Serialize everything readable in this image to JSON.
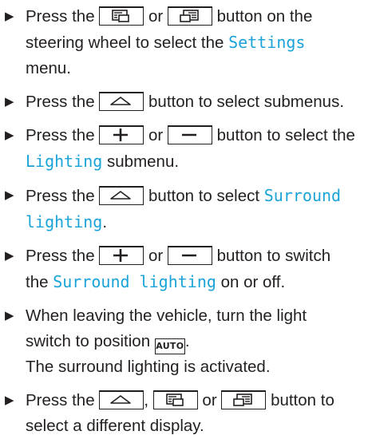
{
  "steps": [
    {
      "pre": "Press the",
      "mid": "or",
      "post": "button on the",
      "line2_pre": "steering wheel to select the",
      "hl": "Settings",
      "line3": "menu."
    },
    {
      "pre": "Press the",
      "post": "button to select submenus."
    },
    {
      "pre": "Press the",
      "mid": "or",
      "post": "button to select the",
      "hl": "Lighting",
      "line2_post": "submenu."
    },
    {
      "pre": "Press the",
      "post": "button to select",
      "hl1": "Surround",
      "hl2": "lighting",
      "end": "."
    },
    {
      "pre": "Press the",
      "mid": "or",
      "post": "button to switch",
      "line2_pre": "the",
      "hl": "Surround lighting",
      "line2_post": "on or off."
    },
    {
      "line1": "When leaving the vehicle, turn the light",
      "line2_pre": "switch to position",
      "auto_label": "AUTO",
      "end": ".",
      "line3": "The surround lighting is activated."
    },
    {
      "pre": "Press the",
      "comma": ",",
      "mid": "or",
      "post": "button to",
      "line2": "select a different display."
    }
  ],
  "icons": {
    "bullet": "arrow-bullet",
    "menu_left": "display-left-icon",
    "menu_right": "display-right-icon",
    "up": "up-triangle-icon",
    "plus": "plus-icon",
    "minus": "minus-icon"
  },
  "colors": {
    "text": "#231f20",
    "highlight": "#1aa3d9"
  }
}
